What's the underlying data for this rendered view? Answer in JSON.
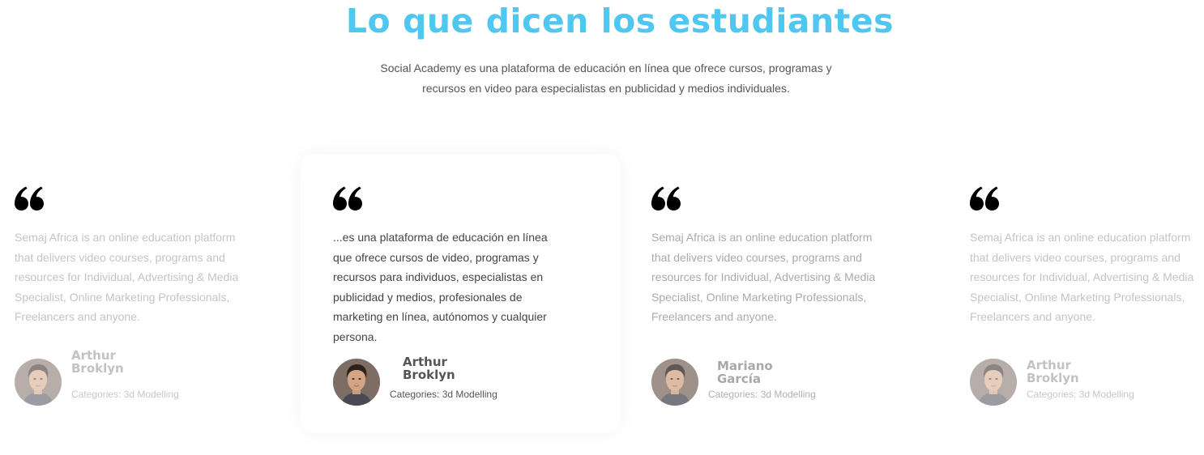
{
  "section": {
    "title": "Lo que dicen los estudiantes",
    "subtitle": "Social Academy es una plataforma de educación en línea que ofrece cursos, programas y recursos en video para especialistas en publicidad y medios individuales."
  },
  "testimonials": [
    {
      "quote": "Semaj Africa is an online education platform that delivers video courses, programs and resources for Individual, Advertising & Media Specialist, Online Marketing Professionals, Freelancers and anyone.",
      "name_line1": "Arthur",
      "name_line2": "Broklyn",
      "category": "Categories: 3d Modelling",
      "icon": "quote-icon",
      "avatar": "avatar-photo"
    },
    {
      "quote": "...es una plataforma de educación en línea que ofrece cursos de video, programas y recursos para individuos, especialistas en publicidad y medios, profesionales de marketing en línea, autónomos y cualquier persona.",
      "name_line1": "Arthur",
      "name_line2": "Broklyn",
      "category": "Categories: 3d Modelling",
      "icon": "quote-icon",
      "avatar": "avatar-photo"
    },
    {
      "quote": "Semaj Africa is an online education platform that delivers video courses, programs and resources for Individual, Advertising & Media Specialist, Online Marketing Professionals, Freelancers and anyone.",
      "name_line1": "Mariano",
      "name_line2": "García",
      "category": "Categories: 3d Modelling",
      "icon": "quote-icon",
      "avatar": "avatar-photo"
    },
    {
      "quote": "Semaj Africa is an online education platform that delivers video courses, programs and resources for Individual, Advertising & Media Specialist, Online Marketing Professionals, Freelancers and anyone.",
      "name_line1": "Arthur",
      "name_line2": "Broklyn",
      "category": "Categories: 3d Modelling",
      "icon": "quote-icon",
      "avatar": "avatar-photo"
    }
  ],
  "colors": {
    "title": "#4fc7f0",
    "active_text": "#444444",
    "faded_text": "#c4c4c4"
  }
}
